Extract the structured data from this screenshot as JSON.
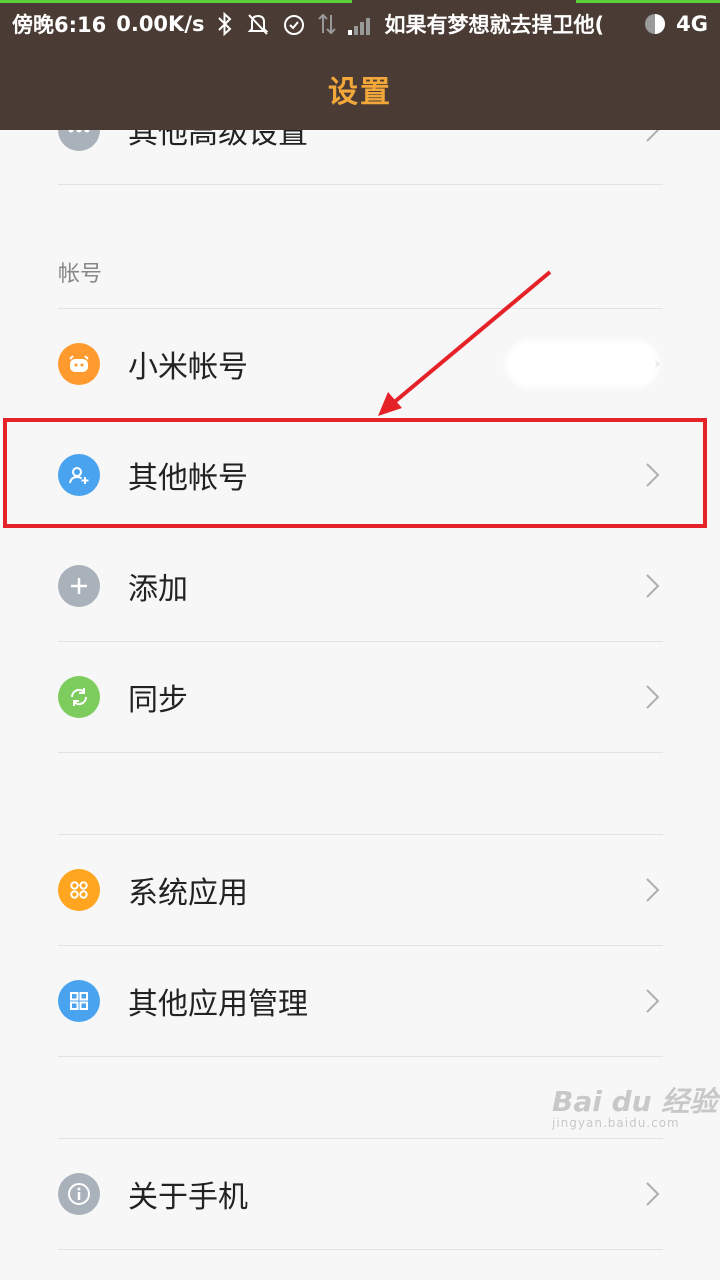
{
  "status_bar": {
    "time": "傍晚6:16",
    "speed": "0.00K/s",
    "carrier": "如果有梦想就去捍卫他(",
    "network": "4G"
  },
  "header": {
    "title": "设置"
  },
  "items": {
    "advanced": "其他高级设置",
    "section_accounts": "帐号",
    "xiaomi_account": "小米帐号",
    "other_accounts": "其他帐号",
    "add": "添加",
    "sync": "同步",
    "system_apps": "系统应用",
    "other_app_management": "其他应用管理",
    "about_phone": "关于手机"
  },
  "colors": {
    "header_bg": "#4a3c34",
    "title": "#f2a73b",
    "highlight": "#e52228",
    "icon_orange": "#ff9a2e",
    "icon_blue": "#4aa3ef",
    "icon_gray": "#a9b1ba",
    "icon_green": "#7ccd5d"
  },
  "watermark": {
    "brand": "Bai du 经验",
    "url": "jingyan.baidu.com"
  }
}
